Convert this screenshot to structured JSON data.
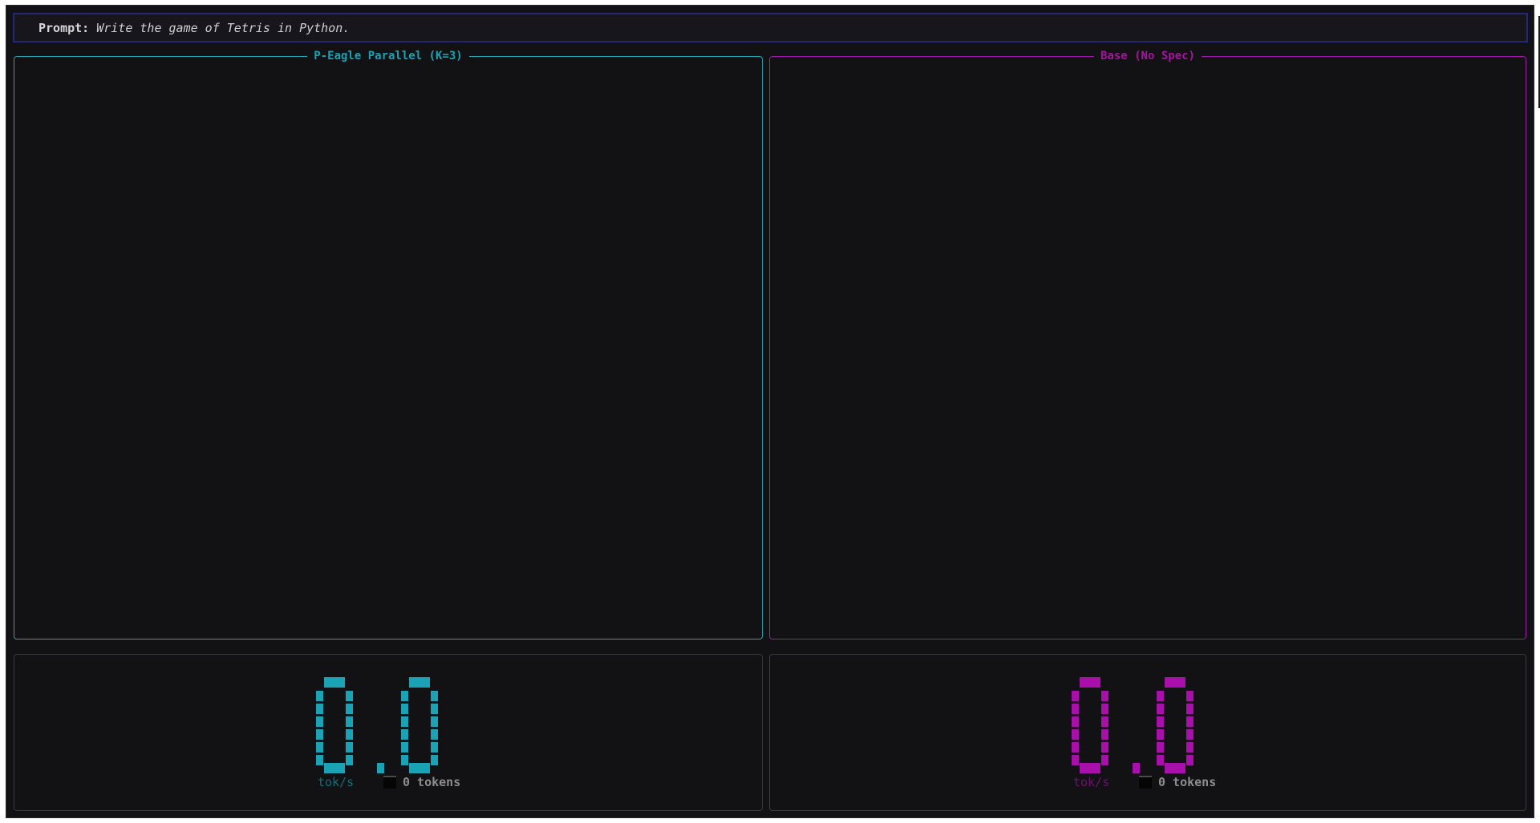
{
  "prompt": {
    "label": "Prompt:",
    "text": "Write the game of Tetris in Python."
  },
  "panels": {
    "left": {
      "title": "P-Eagle Parallel (K=3)",
      "accent": "#17a3b4",
      "output": ""
    },
    "right": {
      "title": "Base (No Spec)",
      "accent": "#a6139f",
      "output": ""
    }
  },
  "stats": {
    "left": {
      "speed": "0.0",
      "unit": "tok/s",
      "tokens": "0 tokens",
      "color": "#1aa3b4"
    },
    "right": {
      "speed": "0.0",
      "unit": "tok/s",
      "tokens": "0 tokens",
      "color": "#a80fab"
    }
  }
}
